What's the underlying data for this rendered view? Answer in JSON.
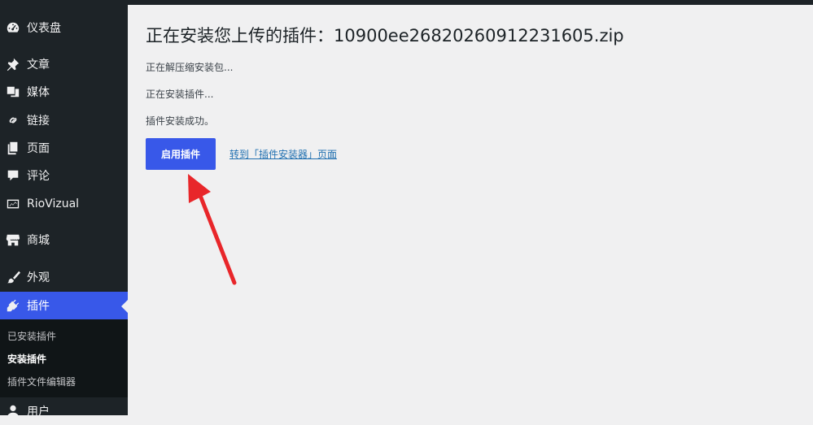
{
  "sidebar": {
    "items": [
      {
        "label": "仪表盘",
        "icon": "dashboard-icon"
      },
      {
        "label": "文章",
        "icon": "pushpin-icon"
      },
      {
        "label": "媒体",
        "icon": "media-icon"
      },
      {
        "label": "链接",
        "icon": "link-icon"
      },
      {
        "label": "页面",
        "icon": "pages-icon"
      },
      {
        "label": "评论",
        "icon": "comment-icon"
      },
      {
        "label": "RioVizual",
        "icon": "riovizual-icon"
      },
      {
        "label": "商城",
        "icon": "store-icon"
      },
      {
        "label": "外观",
        "icon": "brush-icon"
      },
      {
        "label": "插件",
        "icon": "plugin-icon"
      },
      {
        "label": "用户",
        "icon": "user-icon"
      }
    ],
    "submenu": [
      {
        "label": "已安装插件"
      },
      {
        "label": "安装插件"
      },
      {
        "label": "插件文件编辑器"
      }
    ]
  },
  "main": {
    "title": "正在安装您上传的插件：10900ee26820260912231605.zip",
    "steps": [
      "正在解压缩安装包...",
      "正在安装插件...",
      "插件安装成功。"
    ],
    "activate_label": "启用插件",
    "installer_link": "转到「插件安装器」页面"
  },
  "colors": {
    "sidebar_bg": "#1d2327",
    "accent": "#3858e9",
    "arrow": "#e8262a",
    "link": "#2271b1"
  }
}
